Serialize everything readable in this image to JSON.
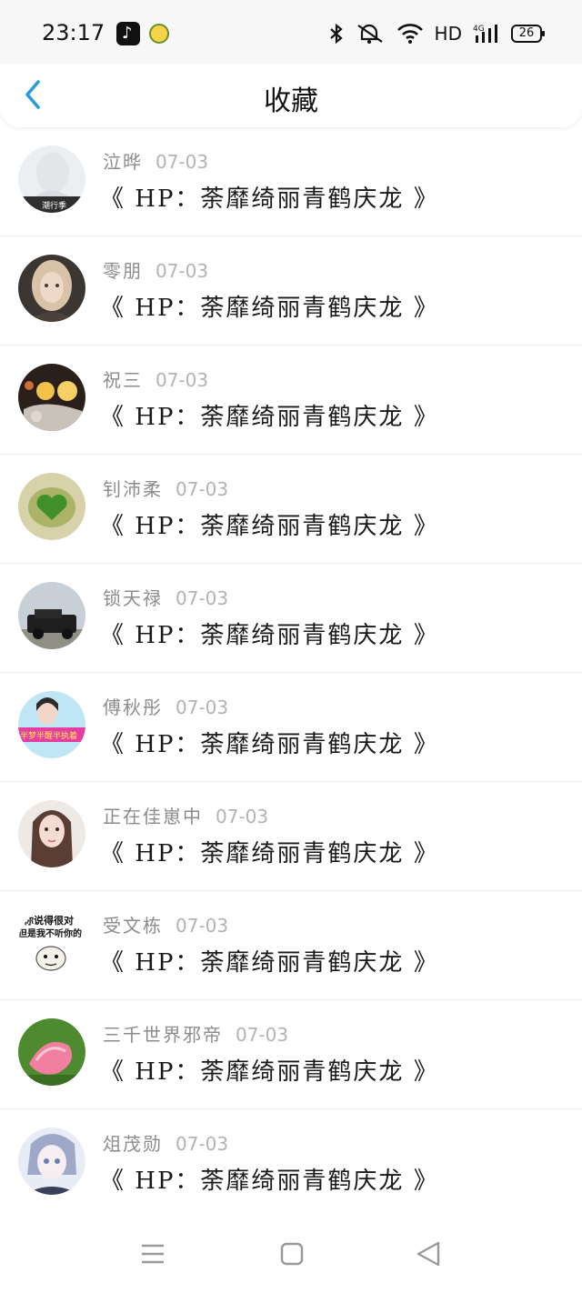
{
  "status_bar": {
    "time": "23:17",
    "network": "HD",
    "signal": "4G",
    "battery": "26",
    "icons": [
      "tiktok-icon",
      "bird-app-icon",
      "bluetooth-icon",
      "mute-icon",
      "wifi-icon",
      "signal-icon",
      "battery-icon"
    ]
  },
  "header": {
    "back_icon": "chevron-left-icon",
    "title": "收藏",
    "accent_color": "#2a9be0"
  },
  "items": [
    {
      "username": "泣晔",
      "date": "07-03",
      "title": "《 HP：荼靡绮丽青鹤庆龙 》",
      "avatar": "avatar-girl-text"
    },
    {
      "username": "零朋",
      "date": "07-03",
      "title": "《 HP：荼靡绮丽青鹤庆龙 》",
      "avatar": "avatar-doll"
    },
    {
      "username": "祝三",
      "date": "07-03",
      "title": "《 HP：荼靡绮丽青鹤庆龙 》",
      "avatar": "avatar-lights"
    },
    {
      "username": "钊沛柔",
      "date": "07-03",
      "title": "《 HP：荼靡绮丽青鹤庆龙 》",
      "avatar": "avatar-green-heart"
    },
    {
      "username": "锁天禄",
      "date": "07-03",
      "title": "《 HP：荼靡绮丽青鹤庆龙 》",
      "avatar": "avatar-car"
    },
    {
      "username": "傅秋彤",
      "date": "07-03",
      "title": "《 HP：荼靡绮丽青鹤庆龙 》",
      "avatar": "avatar-girl-banner"
    },
    {
      "username": "正在佳崽中",
      "date": "07-03",
      "title": "《 HP：荼靡绮丽青鹤庆龙 》",
      "avatar": "avatar-girl-portrait"
    },
    {
      "username": "受文栋",
      "date": "07-03",
      "title": "《 HP：荼靡绮丽青鹤庆龙 》",
      "avatar": "avatar-meme"
    },
    {
      "username": "三千世界邪帝",
      "date": "07-03",
      "title": "《 HP：荼靡绮丽青鹤庆龙 》",
      "avatar": "avatar-lotus"
    },
    {
      "username": "俎茂勋",
      "date": "07-03",
      "title": "《 HP：荼靡绮丽青鹤庆龙 》",
      "avatar": "avatar-anime"
    }
  ],
  "avatar_text": {
    "meme_line1": "你说得很对",
    "meme_line2": "但是我不听你的",
    "banner": "半梦半醒半执着",
    "first": "潮行季"
  },
  "nav": {
    "icons": [
      "menu-icon",
      "home-icon",
      "back-triangle-icon"
    ]
  }
}
